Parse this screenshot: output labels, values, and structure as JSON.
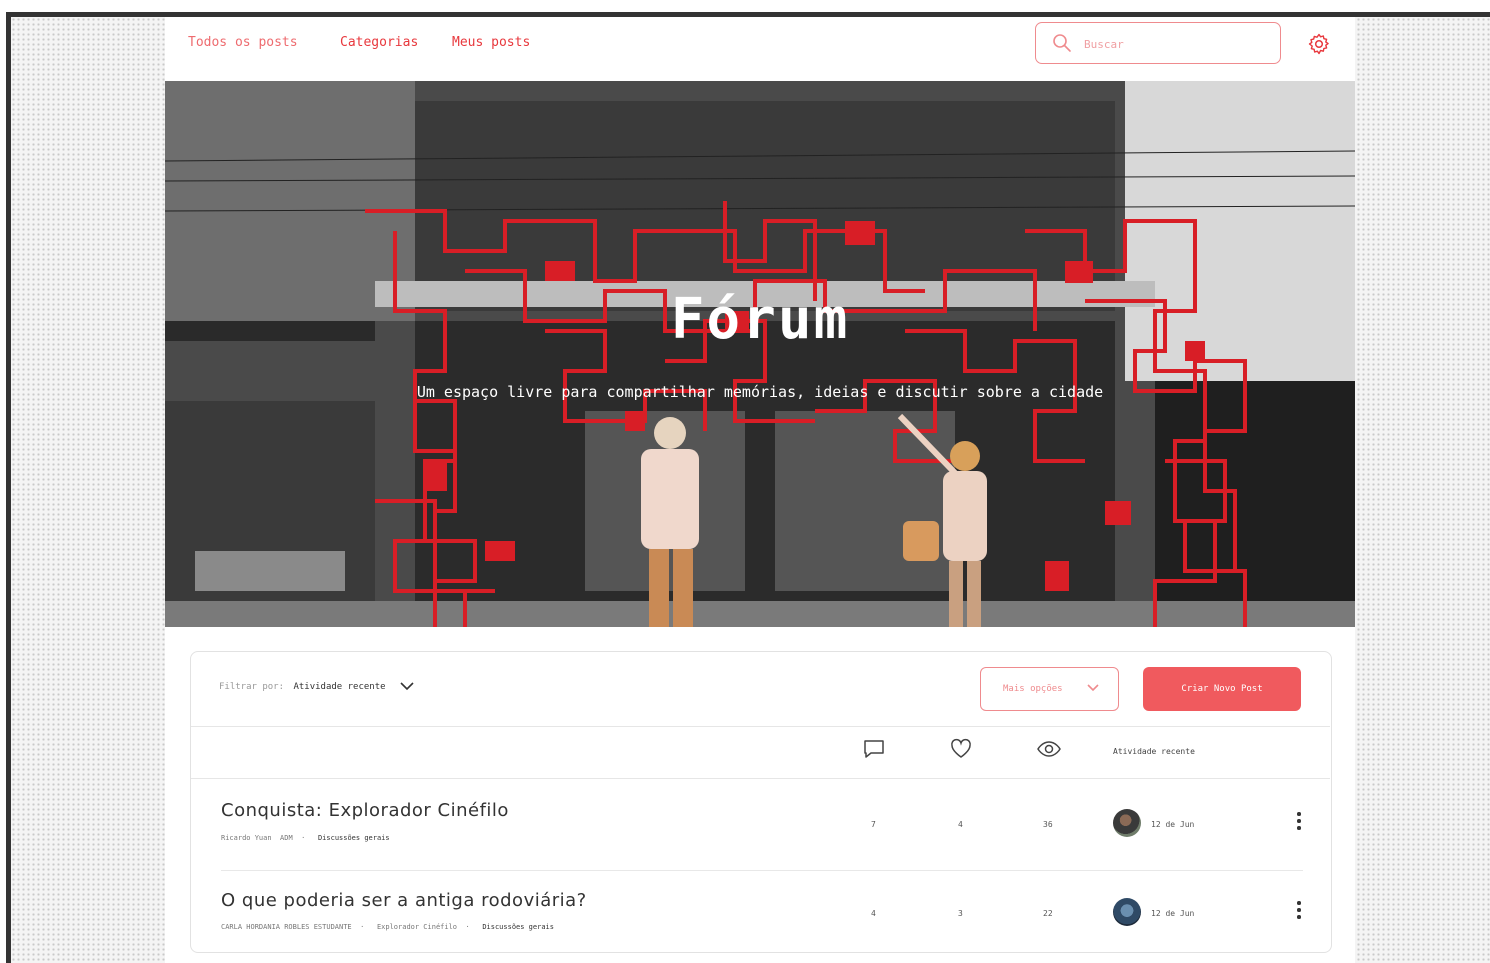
{
  "nav": {
    "links": [
      "Todos os posts",
      "Categorias",
      "Meus posts"
    ],
    "search_placeholder": "Buscar"
  },
  "hero": {
    "title": "Fórum",
    "subtitle": "Um espaço livre para compartilhar memórias, ideias e discutir sobre a cidade"
  },
  "toolbar": {
    "filter_label": "Filtrar por:",
    "filter_value": "Atividade recente",
    "more_options_label": "Mais opções",
    "new_post_label": "Criar Novo Post"
  },
  "table": {
    "header_activity": "Atividade recente",
    "icons": [
      "comment-icon",
      "heart-icon",
      "eye-icon"
    ]
  },
  "posts": [
    {
      "title": "Conquista: Explorador Cinéfilo",
      "author": "Ricardo Yuan",
      "badge": "ADM",
      "category": "Discussões gerais",
      "comments": "7",
      "likes": "4",
      "views": "36",
      "date": "12 de Jun"
    },
    {
      "title": "O que poderia ser a antiga rodoviária?",
      "author": "CARLA HORDANIA ROBLES ESTUDANTE",
      "badge": "Explorador Cinéfilo",
      "category": "Discussões gerais",
      "comments": "4",
      "likes": "3",
      "views": "22",
      "date": "12 de Jun"
    }
  ],
  "colors": {
    "accent": "#e8383d",
    "button": "#f05a5e",
    "border_accent": "#ef8b8e"
  }
}
